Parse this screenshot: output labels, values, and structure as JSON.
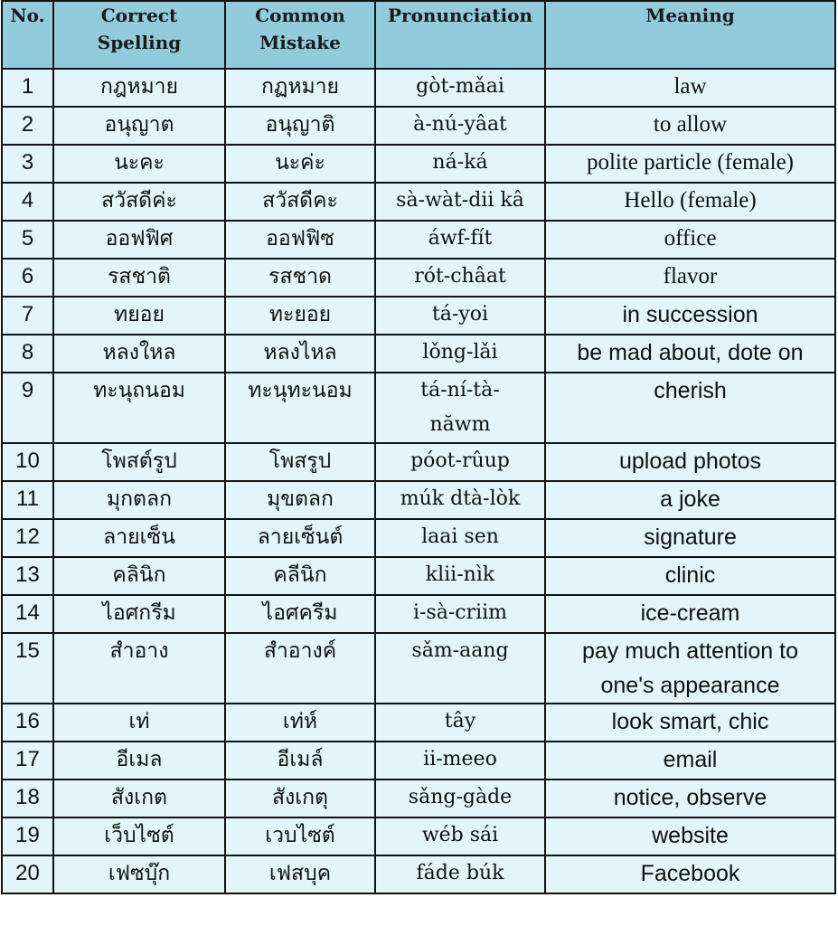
{
  "header": {
    "no": "No.",
    "correct": [
      "Correct",
      "Spelling"
    ],
    "mistake": [
      "Common",
      "Mistake"
    ],
    "pronunciation": "Pronunciation",
    "meaning": "Meaning"
  },
  "colors": {
    "header_bg": "#92cbdc",
    "row_bg": "#e3f4fa",
    "border": "#111111"
  },
  "rows": [
    {
      "no": "1",
      "correct": "กฎหมาย",
      "mistake": "กฏหมาย",
      "pron": "gòt-mǎai",
      "meaning": "law",
      "meaning_style": "serif"
    },
    {
      "no": "2",
      "correct": "อนุญาต",
      "mistake": "อนุญาติ",
      "pron": "à-nú-yâat",
      "meaning": "to allow",
      "meaning_style": "serif"
    },
    {
      "no": "3",
      "correct": "นะคะ",
      "mistake": "นะค่ะ",
      "pron": "ná-ká",
      "meaning": "polite particle (female)",
      "meaning_style": "serif"
    },
    {
      "no": "4",
      "correct": "สวัสดีค่ะ",
      "mistake": "สวัสดีคะ",
      "pron": "sà-wàt-dii kâ",
      "meaning": "Hello (female)",
      "meaning_style": "serif"
    },
    {
      "no": "5",
      "correct": "ออฟฟิศ",
      "mistake": "ออฟฟิซ",
      "pron": "áwf-fít",
      "meaning": "office",
      "meaning_style": "serif"
    },
    {
      "no": "6",
      "correct": "รสชาติ",
      "mistake": "รสชาด",
      "pron": "rót-châat",
      "meaning": "flavor",
      "meaning_style": "serif"
    },
    {
      "no": "7",
      "correct": "ทยอย",
      "mistake": "ทะยอย",
      "pron": "tá-yoi",
      "meaning": "in succession",
      "meaning_style": "sans"
    },
    {
      "no": "8",
      "correct": "หลงใหล",
      "mistake": "หลงไหล",
      "pron": "lǒng-lǎi",
      "meaning": "be mad about, dote on",
      "meaning_style": "sans"
    },
    {
      "no": "9",
      "correct": "ทะนุถนอม",
      "mistake": "ทะนุทะนอม",
      "pron": "tá-ní-tà-năwm",
      "pron_lines": [
        "tá-ní-tà-",
        "năwm"
      ],
      "meaning": "cherish",
      "meaning_style": "sans",
      "tall": true
    },
    {
      "no": "10",
      "correct": "โพสต์รูป",
      "mistake": "โพสรูป",
      "pron": "póot-rûup",
      "meaning": "upload photos",
      "meaning_style": "sans"
    },
    {
      "no": "11",
      "correct": "มุกตลก",
      "mistake": "มุขตลก",
      "pron": "múk dtà-lòk",
      "meaning": "a joke",
      "meaning_style": "sans"
    },
    {
      "no": "12",
      "correct": "ลายเซ็น",
      "mistake": "ลายเซ็นต์",
      "pron": "laai sen",
      "meaning": "signature",
      "meaning_style": "sans"
    },
    {
      "no": "13",
      "correct": "คลินิก",
      "mistake": "คลีนิก",
      "pron": "klii-nìk",
      "meaning": "clinic",
      "meaning_style": "sans"
    },
    {
      "no": "14",
      "correct": "ไอศกรีม",
      "mistake": "ไอศครีม",
      "pron": "i-sà-criim",
      "meaning": "ice-cream",
      "meaning_style": "sans"
    },
    {
      "no": "15",
      "correct": "สำอาง",
      "mistake": "สำอางค์",
      "pron": "sǎm-aang",
      "meaning": "pay much attention to one's appearance",
      "meaning_lines": [
        "pay much attention to",
        "one's appearance"
      ],
      "meaning_style": "sans",
      "tall": true
    },
    {
      "no": "16",
      "correct": "เท่",
      "mistake": "เท่ห์",
      "pron": "tây",
      "meaning": "look smart, chic",
      "meaning_style": "sans"
    },
    {
      "no": "17",
      "correct": "อีเมล",
      "mistake": "อีเมล์",
      "pron": "ii-meeo",
      "meaning": "email",
      "meaning_style": "sans"
    },
    {
      "no": "18",
      "correct": "สังเกต",
      "mistake": "สังเกตุ",
      "pron": "sǎng-gàde",
      "meaning": "notice, observe",
      "meaning_style": "sans"
    },
    {
      "no": "19",
      "correct": "เว็บไซต์",
      "mistake": "เวบไซต์",
      "pron": "wéb sái",
      "meaning": "website",
      "meaning_style": "sans"
    },
    {
      "no": "20",
      "correct": "เฟซบุ๊ก",
      "mistake": "เฟสบุค",
      "pron": "fáde búk",
      "meaning": "Facebook",
      "meaning_style": "sans"
    }
  ]
}
